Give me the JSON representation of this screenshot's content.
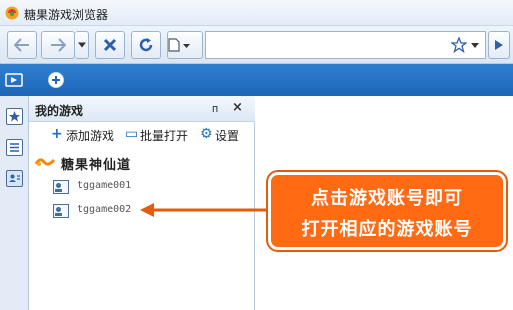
{
  "window": {
    "title": "糖果游戏浏览器"
  },
  "toolbar": {
    "back_icon": "back-arrow-icon",
    "forward_icon": "forward-arrow-icon",
    "stop_icon": "stop-x-icon",
    "refresh_icon": "refresh-icon",
    "page_icon": "page-icon",
    "address_value": "",
    "favorite_icon": "star-icon"
  },
  "tabstrip": {
    "new_tab_icon": "plus-icon"
  },
  "sidebar": {
    "icons": [
      "favorites-star-icon",
      "notes-icon",
      "games-icon"
    ]
  },
  "panel": {
    "title": "我的游戏",
    "pin_glyph": "ᴨ",
    "close_glyph": "×",
    "actions": [
      {
        "glyph": "+",
        "label": "添加游戏"
      },
      {
        "glyph": "▭",
        "label": "批量打开"
      },
      {
        "glyph": "⚙",
        "label": "设置"
      }
    ],
    "game": {
      "name": "糖果神仙道"
    },
    "accounts": [
      {
        "label": "tggame001"
      },
      {
        "label": "tggame002"
      }
    ]
  },
  "callout": {
    "line1": "点击游戏账号即可",
    "line2": "打开相应的游戏账号"
  },
  "colors": {
    "accent_blue": "#1d66b8",
    "callout_orange": "#ff6a13"
  }
}
